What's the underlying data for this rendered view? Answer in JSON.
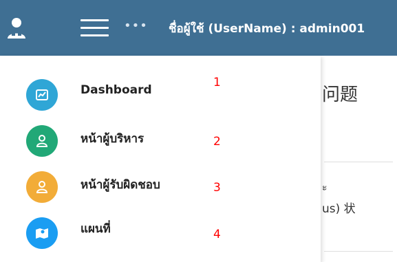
{
  "header": {
    "more_label": "•••",
    "username_text": "ชื่อผู้ใช้ (UserName) : admin001"
  },
  "menu": {
    "items": [
      {
        "label": "Dashboard",
        "icon": "chart-icon",
        "color": "#2fa6d6",
        "annotation": "1"
      },
      {
        "label": "หน้าผู้บริหาร",
        "icon": "user-icon",
        "color": "#21a877",
        "annotation": "2"
      },
      {
        "label": "หน้าผู้รับผิดชอบ",
        "icon": "user-icon",
        "color": "#f2ac38",
        "annotation": "3"
      },
      {
        "label": "แผนที่",
        "icon": "map-icon",
        "color": "#1a9df2",
        "annotation": "4"
      }
    ]
  },
  "background": {
    "title": "问题",
    "text1": "ะ",
    "text2": "us) 状"
  },
  "colors": {
    "header_bg": "#3f6f93",
    "annotation": "#ff0000"
  }
}
